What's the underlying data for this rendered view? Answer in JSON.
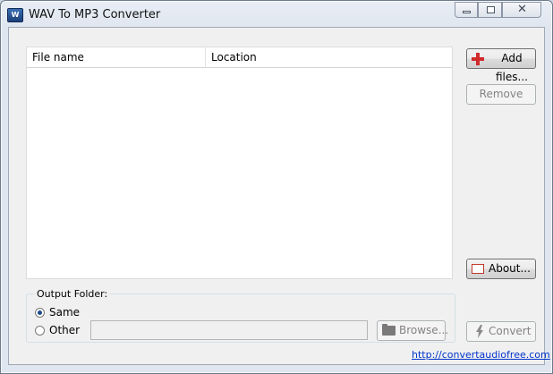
{
  "window": {
    "title": "WAV To MP3 Converter",
    "icon_text": "W",
    "controls": {
      "minimize": "minimize-icon",
      "maximize": "maximize-icon",
      "close": "✕"
    }
  },
  "file_list": {
    "columns": [
      "File name",
      "Location"
    ],
    "rows": []
  },
  "buttons": {
    "add_files": "Add files...",
    "remove": "Remove",
    "about": "About...",
    "convert": "Convert",
    "browse": "Browse..."
  },
  "output": {
    "group_label": "Output Folder:",
    "options": [
      {
        "label": "Same",
        "selected": true
      },
      {
        "label": "Other",
        "selected": false
      }
    ],
    "path_value": ""
  },
  "footer": {
    "link": "http://convertaudiofree.com"
  },
  "colors": {
    "accent_plus": "#d22a2a",
    "link": "#0033cc"
  }
}
